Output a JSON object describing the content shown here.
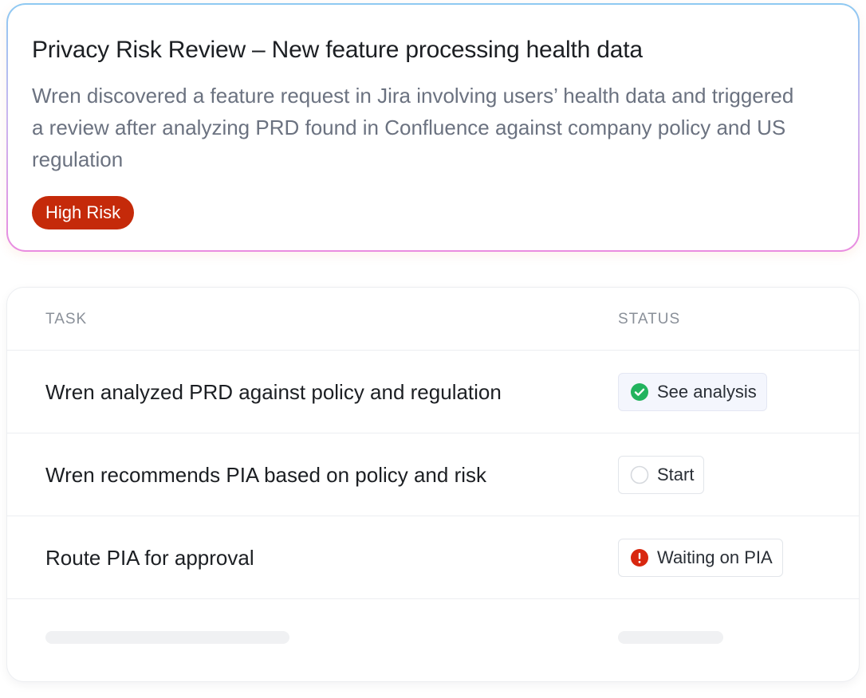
{
  "review": {
    "title": "Privacy Risk Review – New feature processing health data",
    "description": "Wren discovered a feature request in Jira involving users’ health data and triggered a review after analyzing PRD found in Confluence against company policy and US regulation",
    "risk_badge": "High Risk",
    "risk_color": "#c52a0a"
  },
  "tasks": {
    "columns": {
      "task": "TASK",
      "status": "STATUS"
    },
    "rows": [
      {
        "task": "Wren analyzed PRD against policy and regulation",
        "status": "See analysis",
        "status_icon": "check-circle-icon",
        "status_color": "#22b35e"
      },
      {
        "task": "Wren recommends PIA based on policy and risk",
        "status": "Start",
        "status_icon": "empty-circle-icon",
        "status_color": "#d6d9de"
      },
      {
        "task": "Route PIA for approval",
        "status": "Waiting on PIA",
        "status_icon": "alert-circle-icon",
        "status_color": "#d8270f"
      }
    ]
  }
}
